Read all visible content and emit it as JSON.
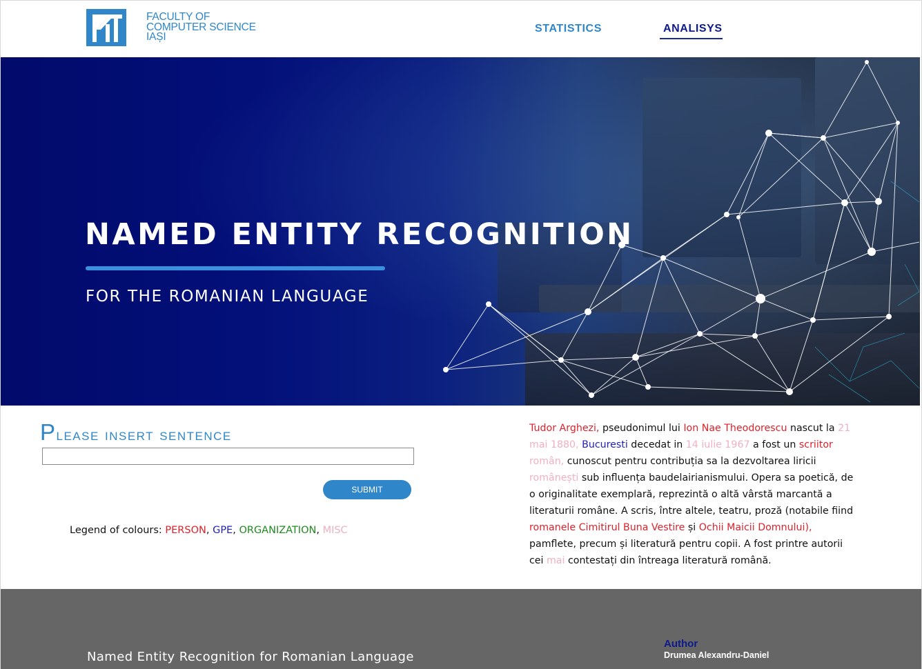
{
  "header": {
    "logo_icon": "fii-logo-icon",
    "logo_lines": [
      "FACULTY OF",
      "COMPUTER SCIENCE",
      "IAȘI"
    ],
    "nav": [
      {
        "label": "STATISTICS",
        "active": false
      },
      {
        "label": "ANALISYS",
        "active": true
      }
    ]
  },
  "hero": {
    "title": "NAMED ENTITY RECOGNITION",
    "subtitle": "FOR THE ROMANIAN LANGUAGE"
  },
  "form": {
    "title": "Please insert sentence",
    "input_value": "",
    "input_placeholder": "",
    "submit_label": "Submit"
  },
  "legend": {
    "label": "Legend of colours: ",
    "items": [
      {
        "text": "PERSON",
        "color": "#e0202a"
      },
      {
        "text": "GPE",
        "color": "#2020c0"
      },
      {
        "text": "ORGANIZATION",
        "color": "#1e8a1e"
      },
      {
        "text": "MISC",
        "color": "#f0b0c0"
      }
    ]
  },
  "result": {
    "segments": [
      {
        "text": "Tudor Arghezi,",
        "type": "PERSON"
      },
      {
        "text": " pseudonimul lui ",
        "type": null
      },
      {
        "text": "Ion Nae Theodorescu",
        "type": "PERSON"
      },
      {
        "text": " nascut la ",
        "type": null
      },
      {
        "text": "21 mai 1880,",
        "type": "MISC"
      },
      {
        "text": " ",
        "type": null
      },
      {
        "text": "Bucuresti",
        "type": "GPE"
      },
      {
        "text": " decedat in ",
        "type": null
      },
      {
        "text": "14 iulie 1967",
        "type": "MISC"
      },
      {
        "text": " a fost un ",
        "type": null
      },
      {
        "text": "scriitor",
        "type": "PERSON"
      },
      {
        "text": " ",
        "type": null
      },
      {
        "text": "român,",
        "type": "MISC"
      },
      {
        "text": " cunoscut pentru contribuția sa la dezvoltarea liricii ",
        "type": null
      },
      {
        "text": "românești",
        "type": "MISC"
      },
      {
        "text": " sub influența baudelairianismului. Opera sa poetică, de o originalitate exemplară, reprezintă o altă vârstă marcantă a literaturii române. A scris, între altele, teatru, proză (notabile fiind ",
        "type": null
      },
      {
        "text": "romanele Cimitirul Buna Vestire",
        "type": "PERSON"
      },
      {
        "text": " și ",
        "type": null
      },
      {
        "text": "Ochii Maicii Domnului),",
        "type": "PERSON"
      },
      {
        "text": " pamflete, precum și literatură pentru copii. A fost printre autorii cei ",
        "type": null
      },
      {
        "text": "mai",
        "type": "MISC"
      },
      {
        "text": " contestați din întreaga literatură română.",
        "type": null
      }
    ]
  },
  "footer": {
    "title": "Named Entity Recognition for Romanian Language",
    "author_label": "Author",
    "author_name": "Drumea Alexandru-Daniel"
  },
  "colors": {
    "accent": "#2f86c8",
    "nav_active": "#0e1a8a",
    "footer_bg": "#666666",
    "hero_bg": "#03107a"
  }
}
